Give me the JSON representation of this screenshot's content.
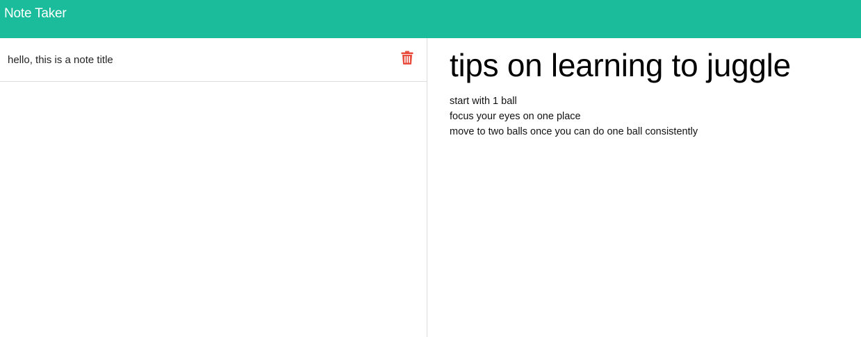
{
  "app": {
    "brand": "Note Taker",
    "accent_color": "#1abc9c",
    "delete_color": "#e74c3c"
  },
  "notes": [
    {
      "title": "hello, this is a note title",
      "delete_icon": "trash-icon"
    }
  ],
  "active_note": {
    "title": "tips on learning to juggle",
    "lines": [
      "start with 1 ball",
      "focus your eyes on one place",
      "move to two balls once you can do one ball consistently"
    ]
  }
}
